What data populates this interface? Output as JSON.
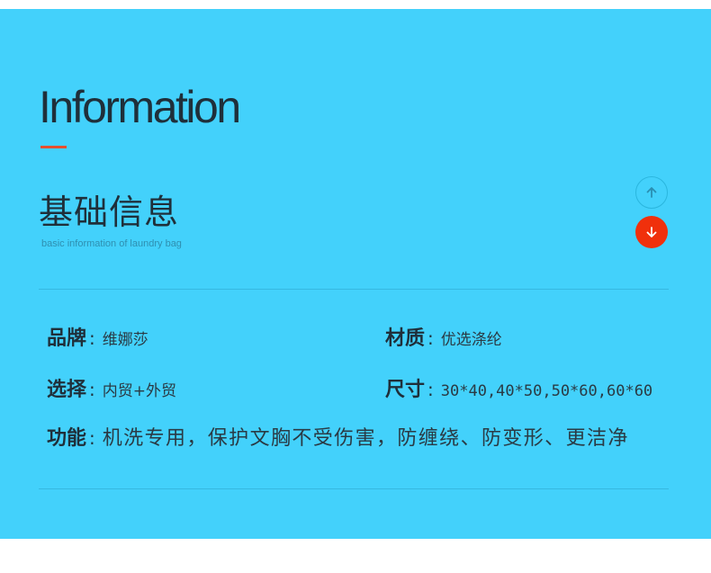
{
  "header": {
    "title": "Information",
    "subtitle": "基础信息",
    "caption": "basic information of laundry bag",
    "accent_color": "#e4502f",
    "background_color": "#43d1fb"
  },
  "nav": {
    "up_icon": "arrow-up-icon",
    "down_icon": "arrow-down-icon",
    "down_color": "#f0300c"
  },
  "specs": {
    "separator": ":",
    "brand": {
      "label": "品牌",
      "value": "维娜莎"
    },
    "material": {
      "label": "材质",
      "value": "优选涤纶"
    },
    "option": {
      "label": "选择",
      "value": "内贸+外贸"
    },
    "size": {
      "label": "尺寸",
      "value": "30*40,40*50,50*60,60*60"
    },
    "function": {
      "label": "功能",
      "value": "机洗专用，保护文胸不受伤害，防缠绕、防变形、更洁净"
    }
  }
}
